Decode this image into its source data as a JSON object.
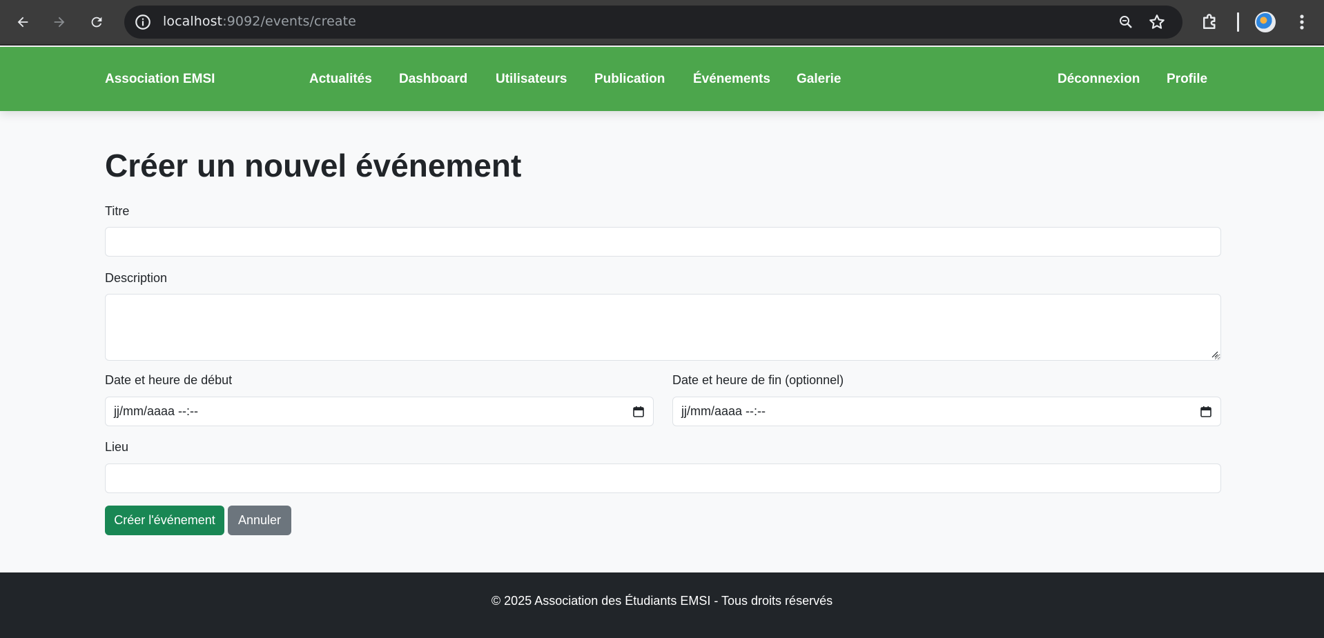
{
  "browser": {
    "url_host": "localhost",
    "url_rest": ":9092/events/create",
    "icons": [
      "back-arrow-icon",
      "forward-arrow-icon",
      "reload-icon",
      "site-info-icon",
      "zoom-icon",
      "bookmark-star-icon",
      "extensions-icon",
      "profile-avatar",
      "more-menu-icon"
    ]
  },
  "navbar": {
    "brand": "Association EMSI",
    "links": [
      "Actualités",
      "Dashboard",
      "Utilisateurs",
      "Publication",
      "Événements",
      "Galerie"
    ],
    "right_links": [
      "Déconnexion",
      "Profile"
    ],
    "color": "#4ca64c"
  },
  "page": {
    "title": "Créer un nouvel événement"
  },
  "form": {
    "titre_label": "Titre",
    "titre_value": "",
    "description_label": "Description",
    "description_value": "",
    "debut_label": "Date et heure de début",
    "debut_placeholder": "jj/mm/aaaa --:--",
    "fin_label": "Date et heure de fin (optionnel)",
    "fin_placeholder": "jj/mm/aaaa --:--",
    "lieu_label": "Lieu",
    "lieu_value": "",
    "submit_label": "Créer l'événement",
    "cancel_label": "Annuler",
    "submit_color": "#198754",
    "cancel_color": "#6c757d"
  },
  "footer": {
    "text": "© 2025 Association des Étudiants EMSI - Tous droits réservés"
  }
}
